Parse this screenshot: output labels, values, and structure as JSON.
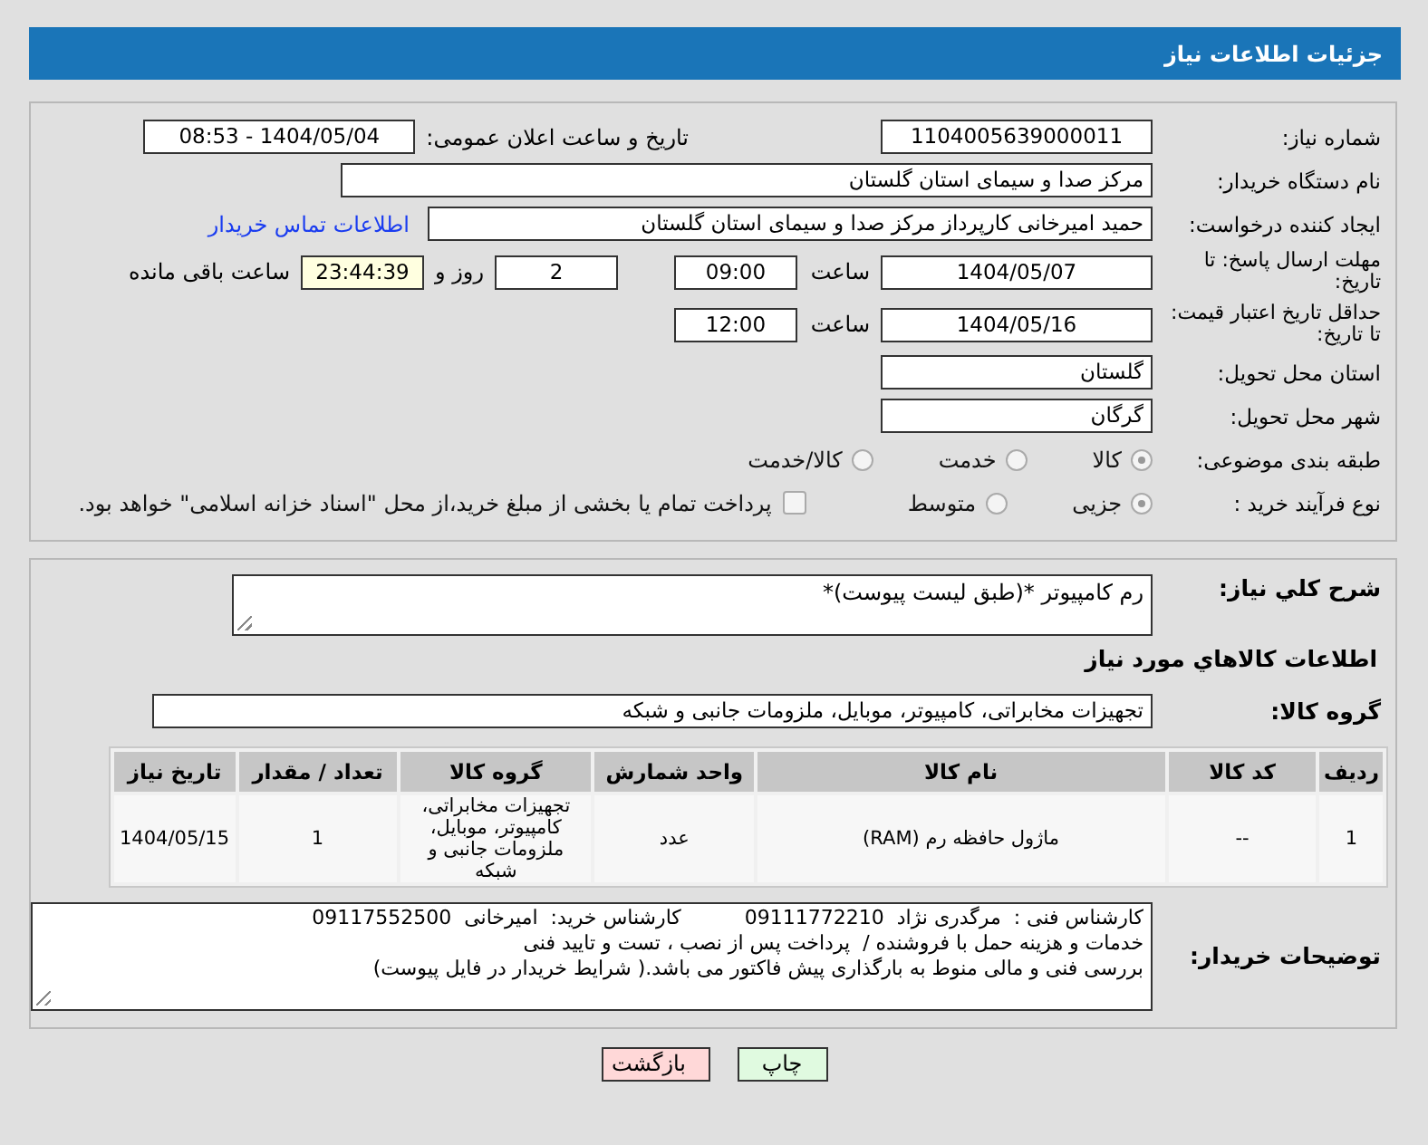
{
  "header": {
    "title": "جزئیات اطلاعات نیاز"
  },
  "need_number": {
    "label": "شماره نیاز:",
    "value": "1104005639000011"
  },
  "announce": {
    "label": "تاریخ و ساعت اعلان عمومی:",
    "value": "1404/05/04 - 08:53"
  },
  "buyer_org": {
    "label": "نام دستگاه خریدار:",
    "value": "مرکز صدا و سیمای استان گلستان"
  },
  "requester": {
    "label": "ایجاد کننده درخواست:",
    "value": "حمید امیرخانی کارپرداز مرکز صدا و سیمای استان گلستان",
    "link": "اطلاعات تماس خریدار"
  },
  "reply_deadline": {
    "label": "مهلت ارسال پاسخ: تا تاریخ:",
    "date": "1404/05/07",
    "time_label": "ساعت",
    "time": "09:00",
    "days": "2",
    "days_label": "روز و",
    "remaining": "23:44:39",
    "remaining_label": "ساعت باقی مانده"
  },
  "price_validity": {
    "label": "حداقل تاریخ اعتبار قیمت: تا تاریخ:",
    "date": "1404/05/16",
    "time_label": "ساعت",
    "time": "12:00"
  },
  "province": {
    "label": "استان محل تحویل:",
    "value": "گلستان"
  },
  "city": {
    "label": "شهر محل تحویل:",
    "value": "گرگان"
  },
  "category": {
    "label": "طبقه بندی موضوعی:",
    "options": [
      {
        "label": "کالا",
        "selected": true
      },
      {
        "label": "خدمت",
        "selected": false
      },
      {
        "label": "کالا/خدمت",
        "selected": false
      }
    ]
  },
  "process": {
    "label": "نوع فرآیند خرید :",
    "options": [
      {
        "label": "جزیی",
        "selected": true
      },
      {
        "label": "متوسط",
        "selected": false
      }
    ],
    "treasury": {
      "label": "پرداخت تمام یا بخشی از مبلغ خرید،از محل \"اسناد خزانه اسلامی\" خواهد بود.",
      "checked": false
    }
  },
  "description": {
    "label": "شرح کلي نیاز:",
    "value": "رم کامپیوتر *(طبق لیست پیوست)*"
  },
  "goods_heading": "اطلاعات کالاهاي مورد نياز",
  "goods_group": {
    "label": "گروه کالا:",
    "value": "تجهیزات مخابراتی، کامپیوتر، موبایل، ملزومات جانبی و شبکه"
  },
  "table": {
    "columns": [
      "ردیف",
      "کد کالا",
      "نام کالا",
      "واحد شمارش",
      "گروه کالا",
      "تعداد / مقدار",
      "تاریخ نیاز"
    ],
    "rows": [
      [
        "1",
        "--",
        "ماژول حافظه رم (RAM)",
        "عدد",
        "تجهیزات مخابراتی، کامپیوتر، موبایل، ملزومات جانبی و شبکه",
        "1",
        "1404/05/15"
      ]
    ]
  },
  "buyer_notes": {
    "label": "توضیحات خریدار:",
    "lines": [
      "کارشناس فنی :  مرگدری نژاد  09111772210          کارشناس خرید:  امیرخانی  09117552500",
      "خدمات و هزینه حمل با فروشنده /  پرداخت پس از نصب ، تست و تایید فنی",
      "بررسی فنی و مالی منوط به بارگذاری پیش فاکتور می باشد.( شرایط خریدار در فایل پیوست)"
    ]
  },
  "buttons": [
    {
      "label": "چاپ",
      "kind": "print"
    },
    {
      "label": "بازگشت",
      "kind": "back"
    }
  ]
}
